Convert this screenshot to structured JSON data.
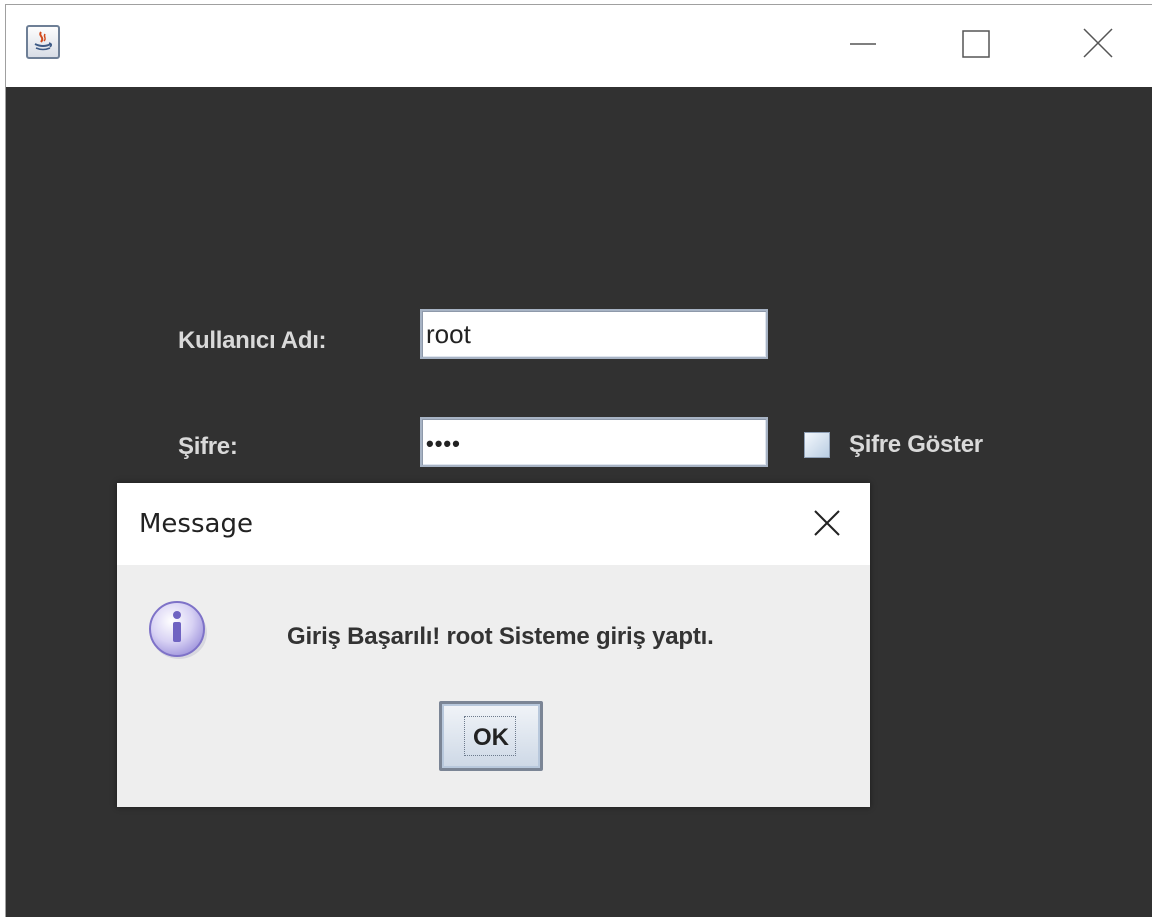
{
  "window": {
    "title": "",
    "minimize_icon": "minimize-icon",
    "maximize_icon": "maximize-icon",
    "close_icon": "close-icon"
  },
  "form": {
    "username_label": "Kullanıcı Adı:",
    "username_value": "root",
    "password_label": "Şifre:",
    "password_value": "••••",
    "show_password_label": "Şifre Göster",
    "show_password_checked": false
  },
  "dialog": {
    "title": "Message",
    "message": "Giriş Başarılı! root Sisteme giriş yaptı.",
    "ok_label": "OK",
    "icon": "info-icon"
  },
  "colors": {
    "content_bg": "#313131",
    "label_text": "#d9d9d9",
    "dialog_bg": "#eeeeee"
  }
}
